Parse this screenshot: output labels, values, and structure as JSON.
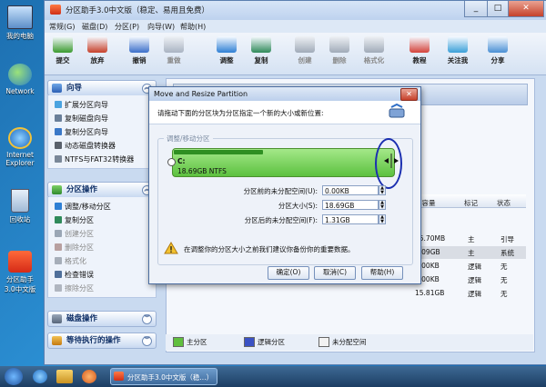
{
  "desktop": {
    "icons": [
      {
        "label": "我的电脑"
      },
      {
        "label": "Network"
      },
      {
        "label": "Internet Explorer"
      },
      {
        "label": "回收站"
      },
      {
        "label": "分区助手3.0中文版"
      }
    ]
  },
  "app": {
    "title": "分区助手3.0中文版（稳定、易用且免费）",
    "menu": [
      "常规(G)",
      "磁盘(D)",
      "分区(P)",
      "向导(W)",
      "帮助(H)"
    ],
    "toolbar": [
      {
        "label": "提交",
        "icon": "check-icon",
        "enabled": true
      },
      {
        "label": "放弃",
        "icon": "discard-icon",
        "enabled": true
      },
      {
        "label": "撤销",
        "icon": "undo-icon",
        "enabled": true
      },
      {
        "label": "重做",
        "icon": "redo-icon",
        "enabled": false
      },
      {
        "label": "调整",
        "icon": "resize-icon",
        "enabled": true
      },
      {
        "label": "复制",
        "icon": "copy-icon",
        "enabled": true
      },
      {
        "label": "创建",
        "icon": "create-icon",
        "enabled": false
      },
      {
        "label": "删除",
        "icon": "delete-icon",
        "enabled": false
      },
      {
        "label": "格式化",
        "icon": "format-icon",
        "enabled": false
      },
      {
        "label": "教程",
        "icon": "tutorial-icon",
        "enabled": true
      },
      {
        "label": "关注我",
        "icon": "follow-icon",
        "enabled": true
      },
      {
        "label": "分享",
        "icon": "share-icon",
        "enabled": true
      }
    ]
  },
  "sidebar": {
    "wizard": {
      "title": "向导",
      "items": [
        "扩展分区向导",
        "复制磁盘向导",
        "复制分区向导",
        "动态磁盘转换器",
        "NTFS与FAT32转换器"
      ]
    },
    "partition_ops": {
      "title": "分区操作",
      "items": [
        {
          "label": "调整/移动分区",
          "enabled": true
        },
        {
          "label": "复制分区",
          "enabled": true
        },
        {
          "label": "创建分区",
          "enabled": false
        },
        {
          "label": "删除分区",
          "enabled": false
        },
        {
          "label": "格式化",
          "enabled": false
        },
        {
          "label": "检查错误",
          "enabled": true
        },
        {
          "label": "擦除分区",
          "enabled": false
        }
      ]
    },
    "disk_ops": {
      "title": "磁盘操作"
    },
    "pending_ops": {
      "title": "等待执行的操作"
    }
  },
  "table": {
    "headers": [
      "用容量",
      "标记",
      "状态"
    ],
    "rows": [
      {
        "used": "75.70MB",
        "flag": "主",
        "status": "引导"
      },
      {
        "used": "8.09GB",
        "flag": "主",
        "status": "系统"
      },
      {
        "used": "0.00KB",
        "flag": "逻辑",
        "status": "无"
      },
      {
        "used": "0.00KB",
        "flag": "逻辑",
        "status": "无"
      },
      {
        "used": "15.81GB",
        "flag": "逻辑",
        "status": "无"
      }
    ]
  },
  "legend": [
    {
      "label": "主分区",
      "color": "#5fbf3e"
    },
    {
      "label": "逻辑分区",
      "color": "#3a52c4"
    },
    {
      "label": "未分配空间",
      "color": "#f2f2f2"
    }
  ],
  "taskbar": {
    "task_label": "分区助手3.0中文版（稳...）"
  },
  "dialog": {
    "title": "Move and Resize Partition",
    "instruction": "请拖动下面的分区块为分区指定一个新的大小或新位置:",
    "group_label": "调整/移动分区",
    "partition_letter": "C:",
    "partition_info": "18.69GB NTFS",
    "partition_used_fraction": 0.43,
    "fields": [
      {
        "label": "分区前的未分配空间(U):",
        "value": "0.00KB"
      },
      {
        "label": "分区大小(S):",
        "value": "18.69GB"
      },
      {
        "label": "分区后的未分配空间(F):",
        "value": "1.31GB"
      }
    ],
    "warning": "在调整你的分区大小之前我们建议你备份你的重要数据。",
    "buttons": [
      "确定(O)",
      "取消(C)",
      "帮助(H)"
    ],
    "close_symbol": "✕"
  },
  "colors": {
    "partition_green": "#5cc13f",
    "partition_bar_dark": "#2f8f22",
    "accent": "#1f4fa0"
  }
}
